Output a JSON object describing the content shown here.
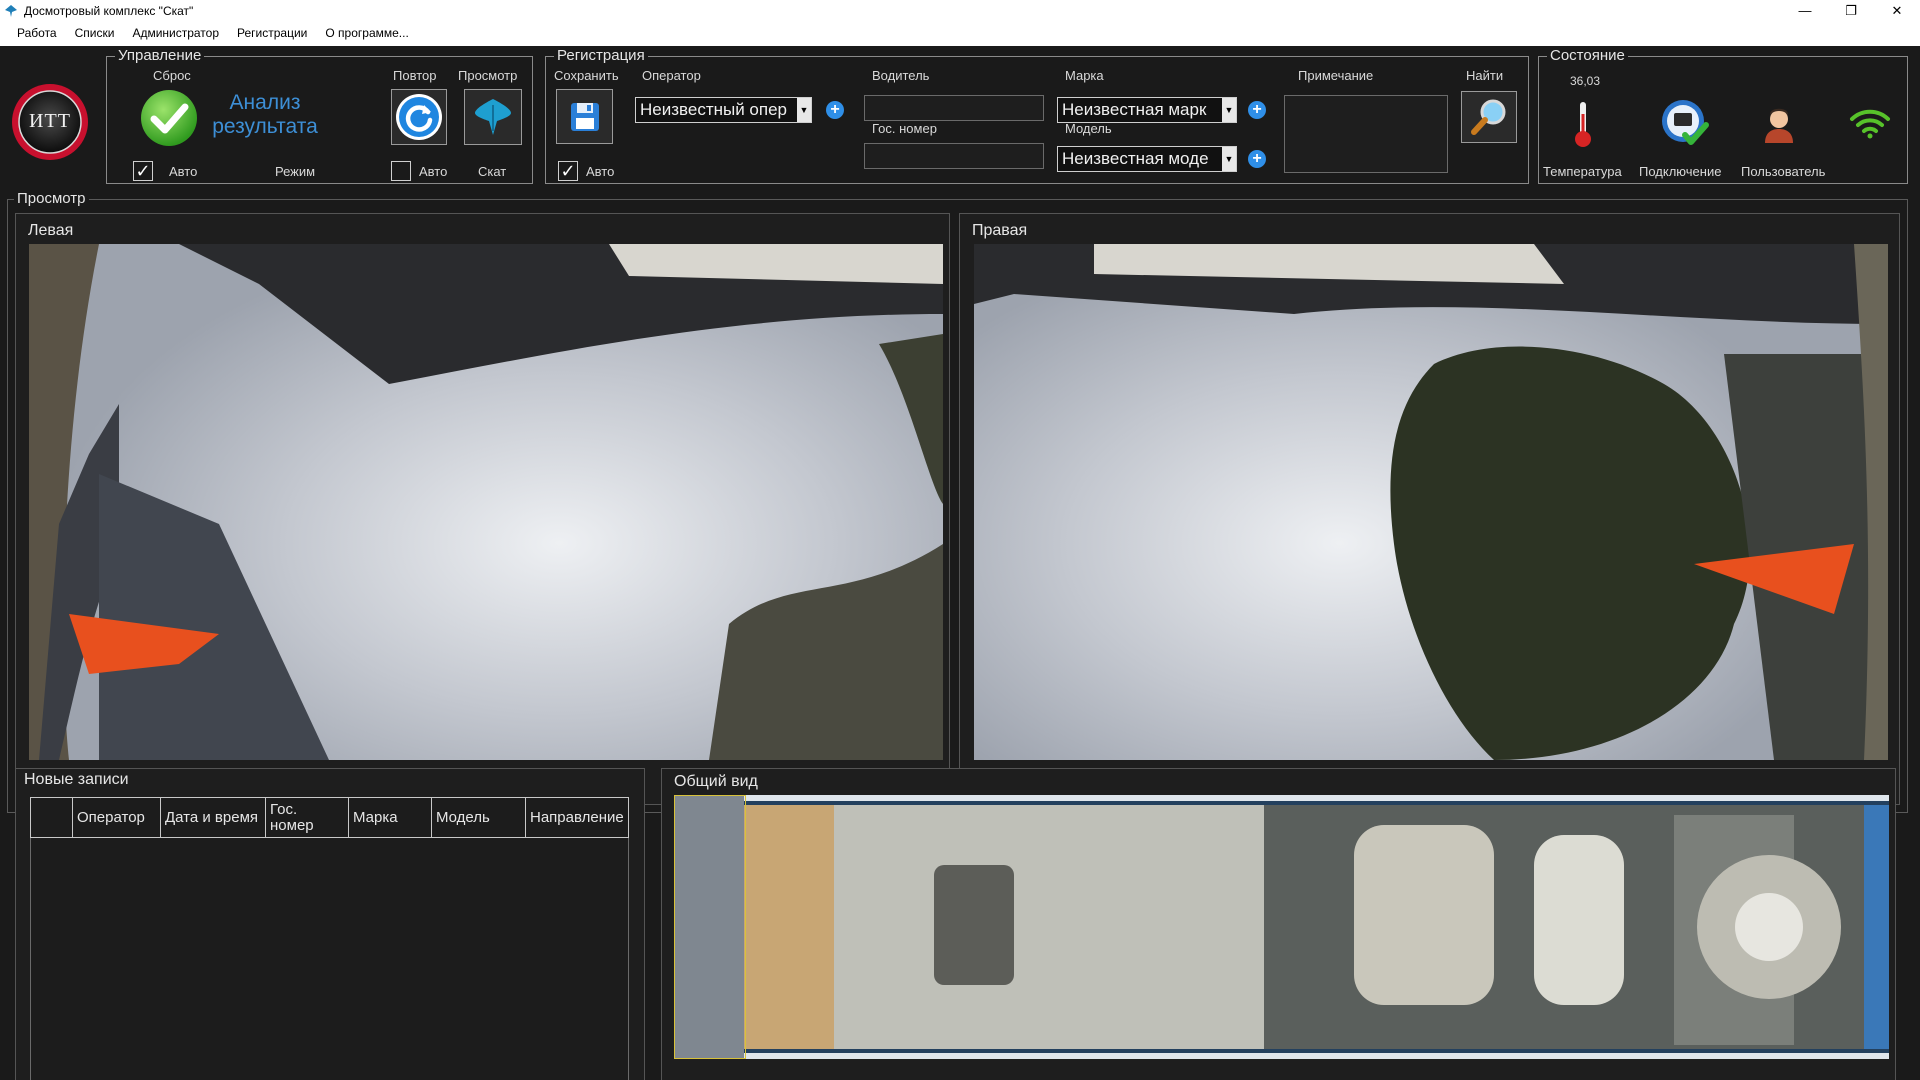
{
  "window": {
    "title": "Досмотровый комплекс \"Скат\"",
    "minimize": "—",
    "restore": "❐",
    "close": "✕"
  },
  "menu": [
    "Работа",
    "Списки",
    "Администратор",
    "Регистрации",
    "О программе..."
  ],
  "logo": {
    "text": "ИТТ"
  },
  "control": {
    "legend": "Управление",
    "reset_label": "Сброс",
    "analysis_text_1": "Анализ",
    "analysis_text_2": "результата",
    "repeat_label": "Повтор",
    "view_label": "Просмотр",
    "auto1_label": "Авто",
    "mode_label": "Режим",
    "auto2_label": "Авто",
    "skat_label": "Скат",
    "auto1_checked": "✓",
    "auto2_checked": ""
  },
  "registration": {
    "legend": "Регистрация",
    "save_label": "Сохранить",
    "operator_label": "Оператор",
    "operator_value": "Неизвестный опер",
    "driver_label": "Водитель",
    "plate_label": "Гос. номер",
    "brand_label": "Марка",
    "brand_value": "Неизвестная марк",
    "model_label": "Модель",
    "model_value": "Неизвестная моде",
    "note_label": "Примечание",
    "find_label": "Найти",
    "auto_label": "Авто",
    "auto_checked": "✓"
  },
  "status": {
    "legend": "Состояние",
    "temperature_value": "36,03",
    "temperature_label": "Температура",
    "connection_label": "Подключение",
    "user_label": "Пользователь"
  },
  "view": {
    "legend": "Просмотр",
    "left_title": "Левая",
    "right_title": "Правая"
  },
  "records": {
    "title": "Новые записи",
    "columns": [
      "",
      "Оператор",
      "Дата и время",
      "Гос. номер",
      "Марка",
      "Модель",
      "Направление"
    ]
  },
  "overview": {
    "title": "Общий вид"
  },
  "colors": {
    "background": "#1a1a1a",
    "accent_blue": "#2f8fe8",
    "analysis_text": "#3d8fd6",
    "cone_orange": "#e8501e",
    "sky": "#c9ccd2"
  }
}
